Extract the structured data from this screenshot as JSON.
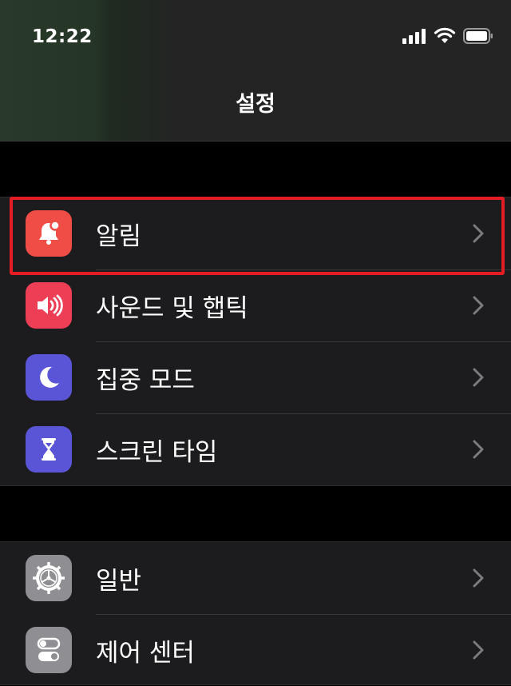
{
  "status_bar": {
    "time": "12:22"
  },
  "nav": {
    "title": "설정"
  },
  "group1": {
    "items": [
      {
        "label": "알림",
        "icon": "bell-badge-icon",
        "color": "#ef4d45"
      },
      {
        "label": "사운드 및 햅틱",
        "icon": "speaker-icon",
        "color": "#ec3f55"
      },
      {
        "label": "집중 모드",
        "icon": "moon-icon",
        "color": "#5a55d6"
      },
      {
        "label": "스크린 타임",
        "icon": "hourglass-icon",
        "color": "#5a55d6"
      }
    ]
  },
  "group2": {
    "items": [
      {
        "label": "일반",
        "icon": "gear-icon",
        "color": "#8e8e93"
      },
      {
        "label": "제어 센터",
        "icon": "toggles-icon",
        "color": "#8e8e93"
      }
    ]
  },
  "highlight_color": "#e51c23"
}
